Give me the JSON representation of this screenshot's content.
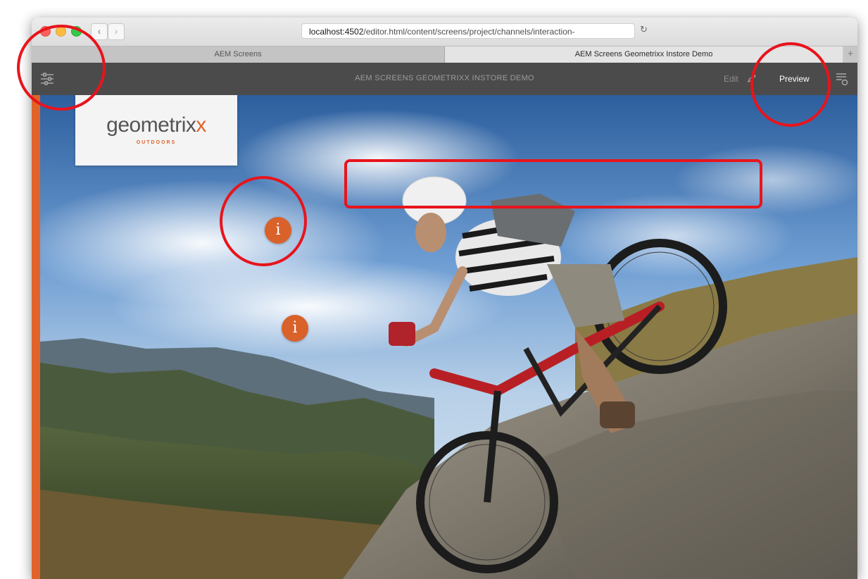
{
  "browser": {
    "url_host": "localhost:4502",
    "url_path": "/editor.html/content/screens/project/channels/interaction-",
    "tabs": [
      {
        "label": "AEM Screens"
      },
      {
        "label": "AEM Screens Geometrixx Instore Demo"
      }
    ],
    "new_tab_label": "+"
  },
  "aem": {
    "title": "AEM SCREENS GEOMETRIXX INSTORE DEMO",
    "edit_label": "Edit",
    "preview_label": "Preview",
    "accent_color": "#e0632b"
  },
  "content": {
    "logo": {
      "text_main": "geometrix",
      "text_x": "x",
      "subtext": "OUTDOORS"
    },
    "hotspots": [
      {
        "icon": "info-icon",
        "glyph": "i"
      },
      {
        "icon": "info-icon",
        "glyph": "i"
      }
    ]
  },
  "annotations": {
    "color": "#e8141c"
  }
}
